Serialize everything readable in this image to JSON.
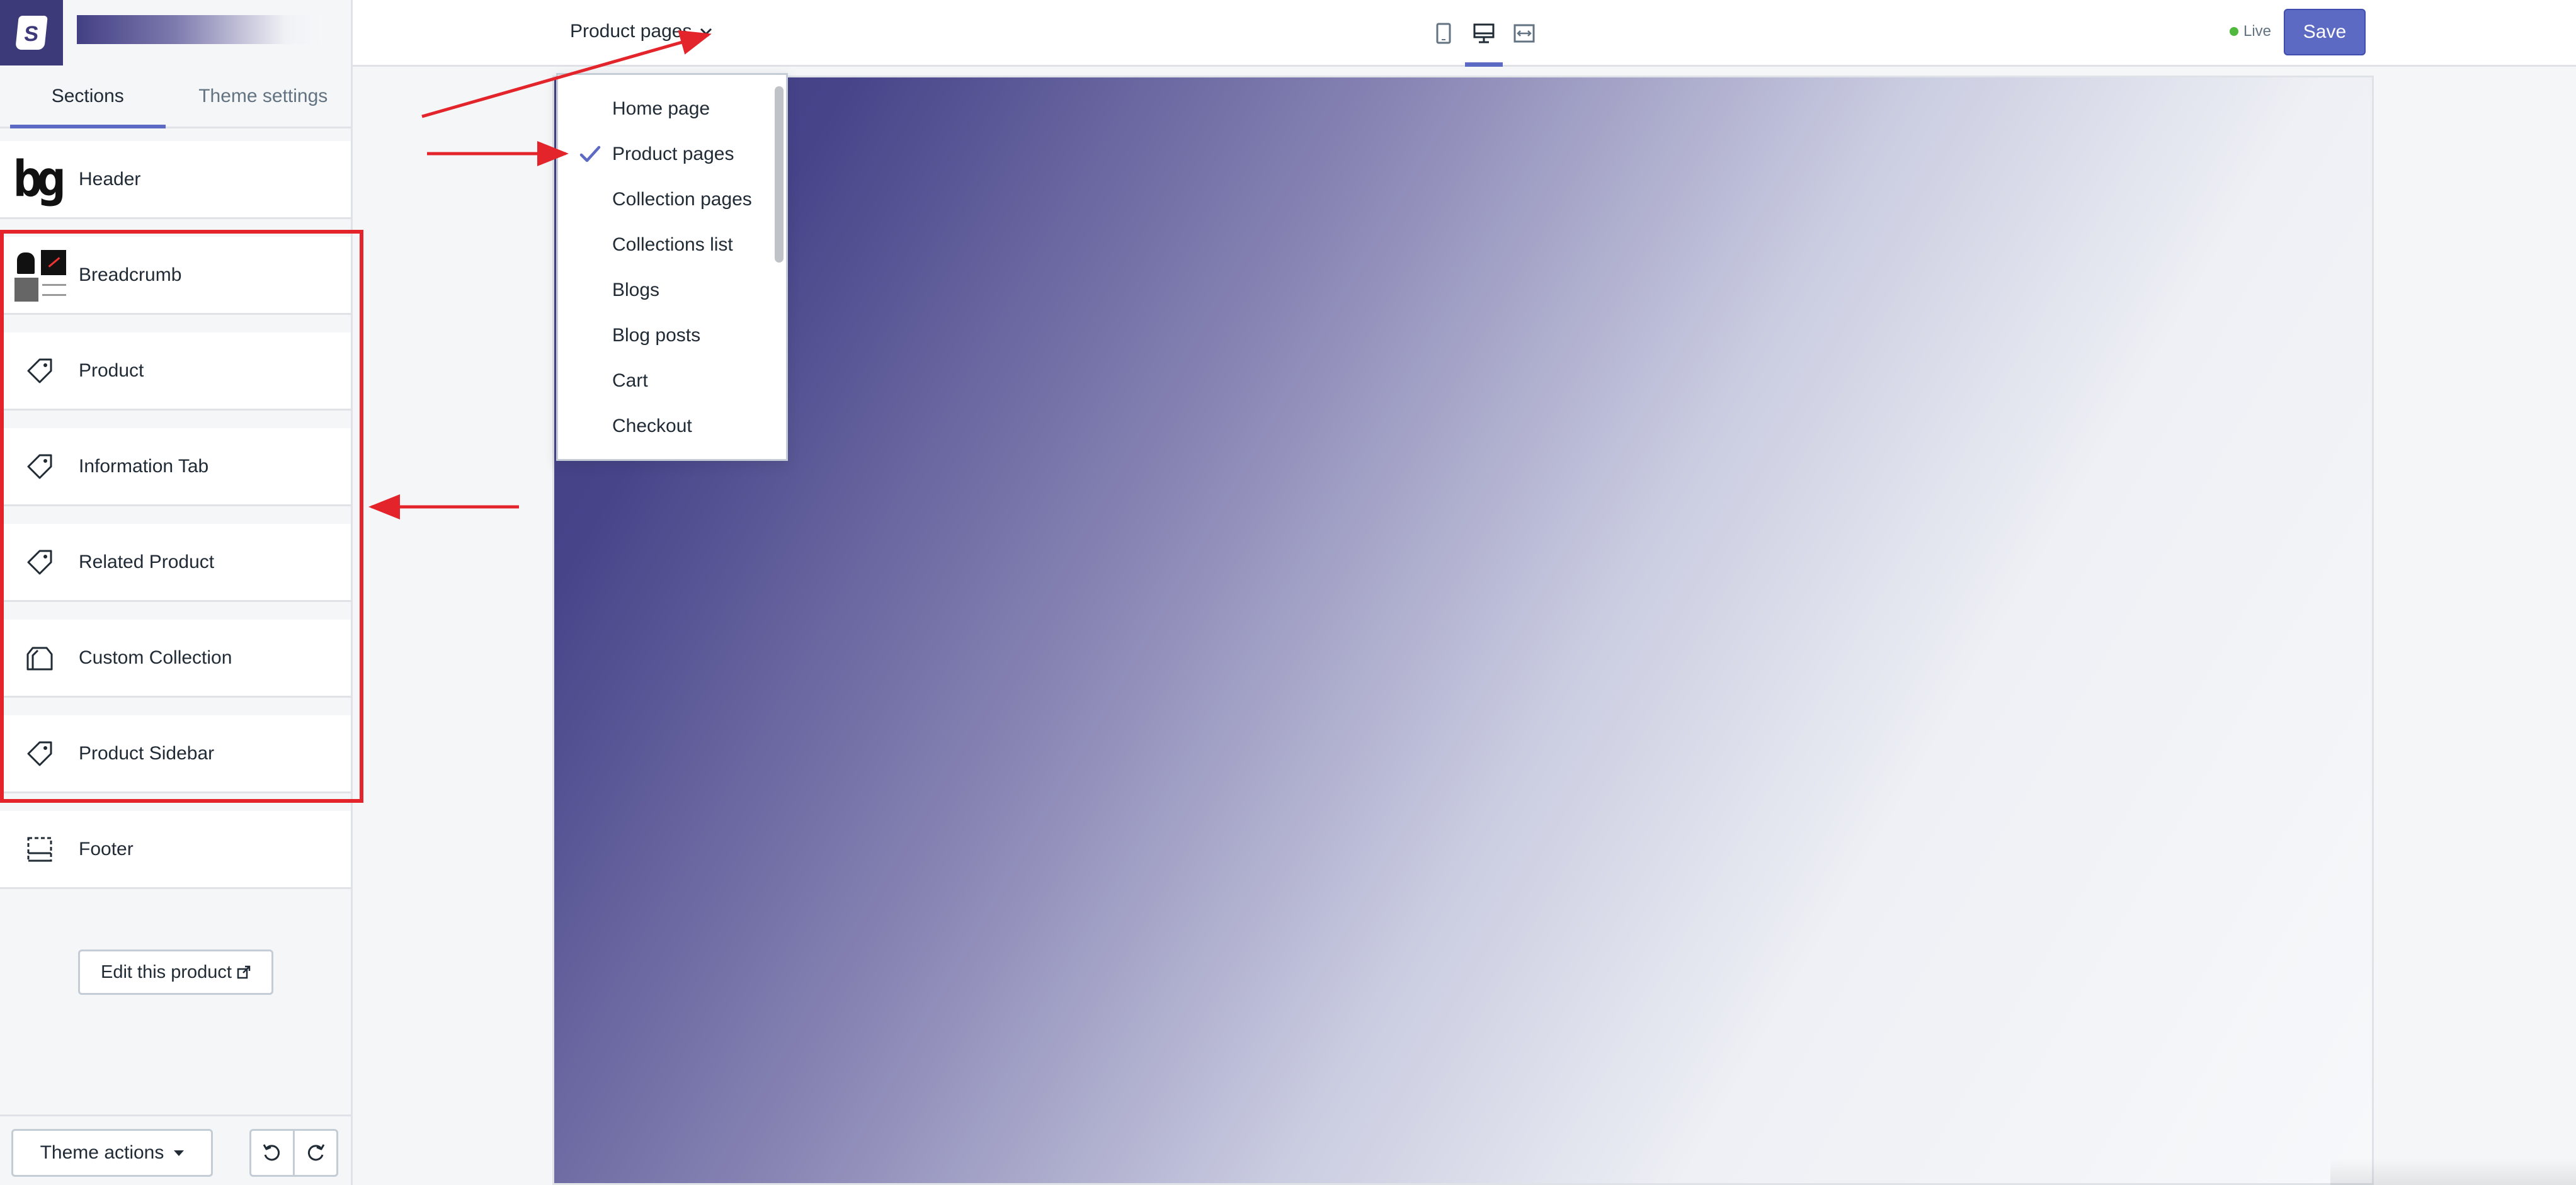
{
  "brand": {
    "icon": "shopify-bag-icon"
  },
  "sidebar": {
    "tabs": [
      {
        "label": "Sections",
        "active": true
      },
      {
        "label": "Theme settings",
        "active": false
      }
    ],
    "sections": [
      {
        "label": "Header",
        "icon": "header-thumbnail"
      },
      {
        "label": "Breadcrumb",
        "icon": "breadcrumb-thumbnail"
      },
      {
        "label": "Product",
        "icon": "tag-icon"
      },
      {
        "label": "Information Tab",
        "icon": "tag-icon"
      },
      {
        "label": "Related Product",
        "icon": "tag-icon"
      },
      {
        "label": "Custom Collection",
        "icon": "collection-icon"
      },
      {
        "label": "Product Sidebar",
        "icon": "tag-icon"
      },
      {
        "label": "Footer",
        "icon": "footer-icon"
      }
    ],
    "edit_button": "Edit this product",
    "bottom": {
      "theme_actions": "Theme actions"
    }
  },
  "topbar": {
    "page_select": "Product pages",
    "live_label": "Live",
    "save_label": "Save",
    "devices": [
      "mobile",
      "desktop",
      "fullscreen"
    ],
    "active_device": "desktop"
  },
  "dropdown": {
    "selected": "Product pages",
    "items": [
      "Home page",
      "Product pages",
      "Collection pages",
      "Collections list",
      "Blogs",
      "Blog posts",
      "Cart",
      "Checkout"
    ]
  },
  "colors": {
    "accent": "#5c6ac4",
    "annotation": "#e3242b",
    "live": "#50b83c",
    "brand": "#3d3a7a"
  }
}
